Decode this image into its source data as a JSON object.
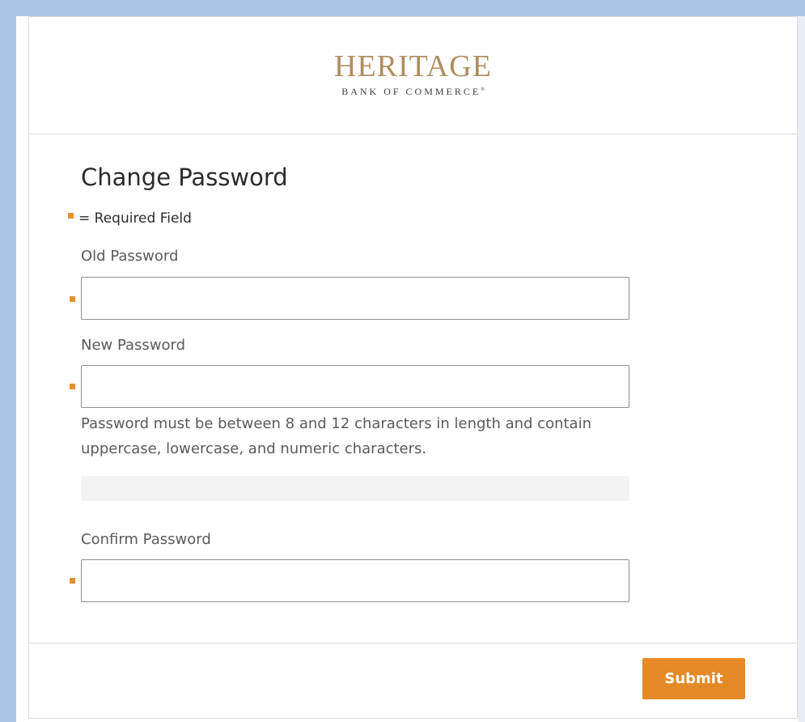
{
  "brand": {
    "name": "HERITAGE",
    "tagline": "BANK OF COMMERCE",
    "trademark": "®"
  },
  "form": {
    "title": "Change Password",
    "required_note": "= Required Field",
    "fields": [
      {
        "label": "Old Password",
        "value": "",
        "placeholder": ""
      },
      {
        "label": "New Password",
        "value": "",
        "placeholder": ""
      },
      {
        "label": "Confirm Password",
        "value": "",
        "placeholder": ""
      }
    ],
    "password_hint": "Password must be between 8 and 12 characters in length and contain uppercase, lowercase, and numeric characters.",
    "strength_meter": {
      "fill": 0
    },
    "submit_label": "Submit"
  },
  "colors": {
    "frame": "#a9c6e6",
    "accent": "#e48a27",
    "brand_gold": "#b08d5f"
  }
}
